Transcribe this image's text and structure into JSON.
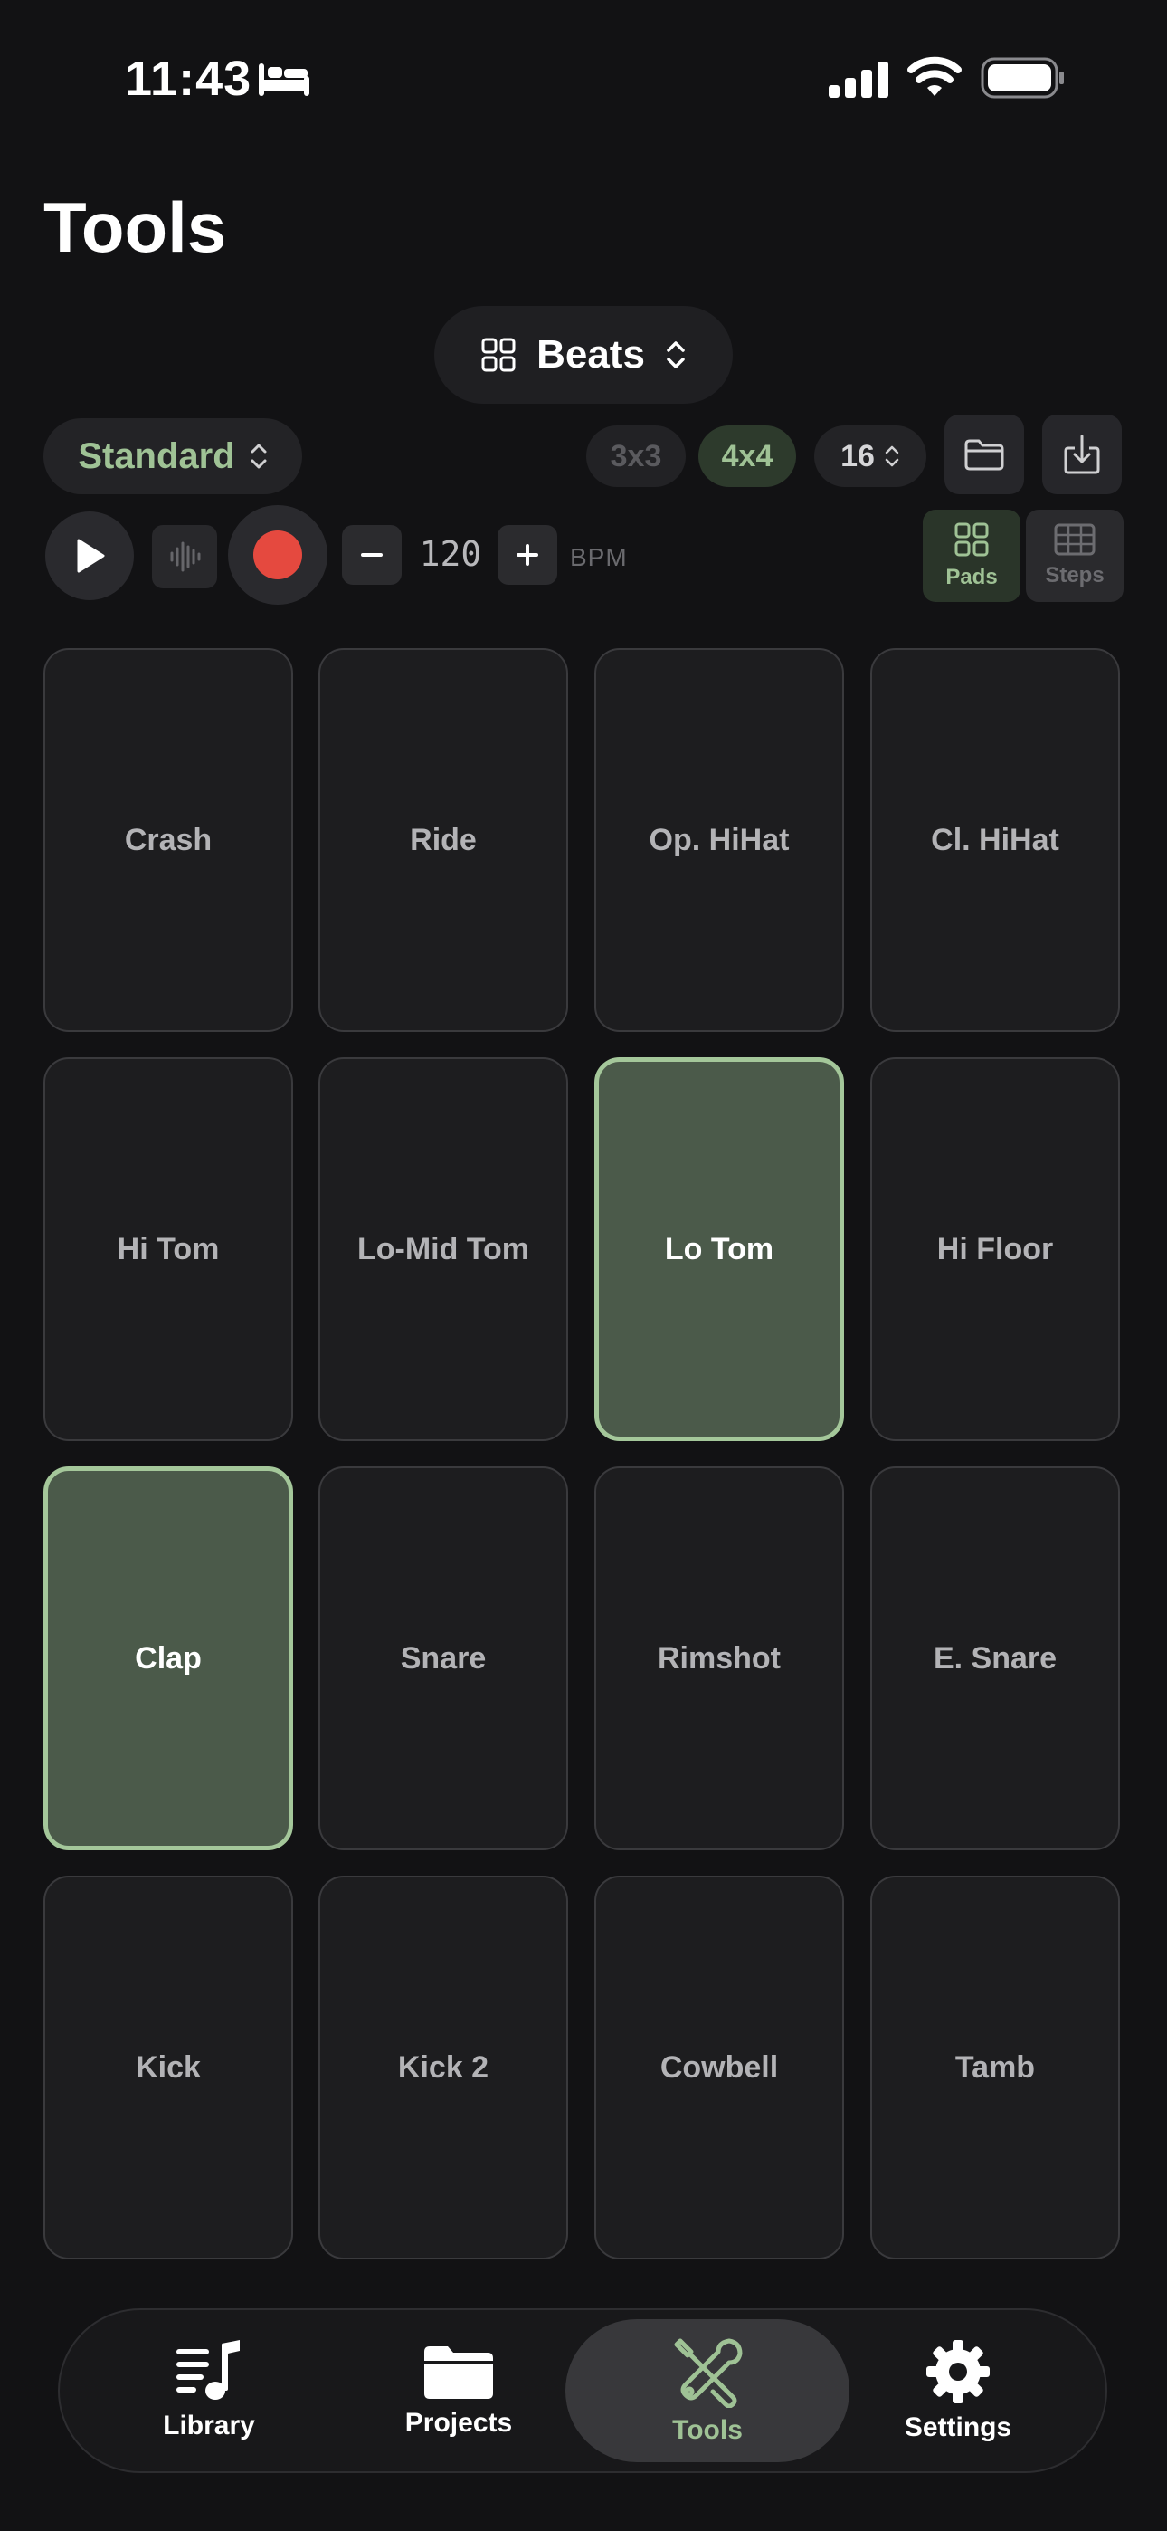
{
  "status": {
    "time": "11:43"
  },
  "page": {
    "title": "Tools"
  },
  "selector": {
    "label": "Beats"
  },
  "kit": {
    "label": "Standard"
  },
  "grid_options": {
    "small": "3x3",
    "large": "4x4",
    "steps": "16"
  },
  "transport": {
    "bpm": "120",
    "bpm_unit": "BPM"
  },
  "modes": {
    "pads": "Pads",
    "steps": "Steps"
  },
  "pads": [
    {
      "label": "Crash",
      "active": false
    },
    {
      "label": "Ride",
      "active": false
    },
    {
      "label": "Op. HiHat",
      "active": false
    },
    {
      "label": "Cl. HiHat",
      "active": false
    },
    {
      "label": "Hi Tom",
      "active": false
    },
    {
      "label": "Lo-Mid Tom",
      "active": false
    },
    {
      "label": "Lo Tom",
      "active": true
    },
    {
      "label": "Hi Floor",
      "active": false
    },
    {
      "label": "Clap",
      "active": true
    },
    {
      "label": "Snare",
      "active": false
    },
    {
      "label": "Rimshot",
      "active": false
    },
    {
      "label": "E. Snare",
      "active": false
    },
    {
      "label": "Kick",
      "active": false
    },
    {
      "label": "Kick 2",
      "active": false
    },
    {
      "label": "Cowbell",
      "active": false
    },
    {
      "label": "Tamb",
      "active": false
    }
  ],
  "tabs": [
    {
      "label": "Library",
      "icon": "music-list-icon"
    },
    {
      "label": "Projects",
      "icon": "folder-icon"
    },
    {
      "label": "Tools",
      "icon": "tools-icon",
      "active": true
    },
    {
      "label": "Settings",
      "icon": "gear-icon"
    }
  ],
  "colors": {
    "accent": "#9fc295",
    "active_pad": "#4b5a4a",
    "record": "#e5493f",
    "background": "#121214"
  }
}
